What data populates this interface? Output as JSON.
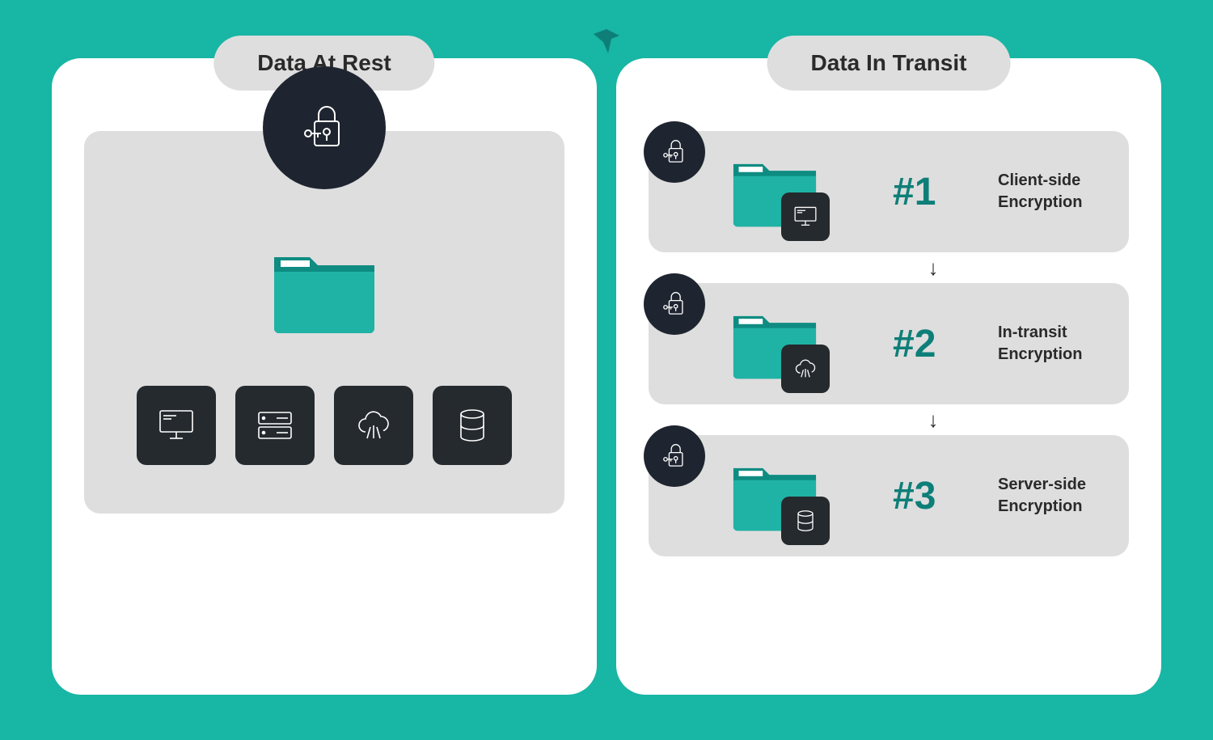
{
  "left": {
    "title": "Data At Rest",
    "lock_icon": "lock-key-icon",
    "folder_icon": "folder-icon",
    "storage_icons": [
      {
        "name": "desktop-computer-icon"
      },
      {
        "name": "server-rack-icon"
      },
      {
        "name": "cloud-icon"
      },
      {
        "name": "database-icon"
      }
    ]
  },
  "right": {
    "title": "Data In Transit",
    "steps": [
      {
        "num": "#1",
        "label_line1": "Client-side",
        "label_line2": "Encryption",
        "overlay_icon": "desktop-computer-icon"
      },
      {
        "num": "#2",
        "label_line1": "In-transit",
        "label_line2": "Encryption",
        "overlay_icon": "cloud-icon"
      },
      {
        "num": "#3",
        "label_line1": "Server-side",
        "label_line2": "Encryption",
        "overlay_icon": "database-icon"
      }
    ],
    "arrow": "↓"
  },
  "colors": {
    "bg": "#18b6a4",
    "panel": "#ffffff",
    "box": "#dedede",
    "dark": "#1f2530",
    "tile": "#252a2e",
    "accent": "#0e7f78",
    "folder": "#1fb3a6",
    "folder_dark": "#0e8c82"
  }
}
